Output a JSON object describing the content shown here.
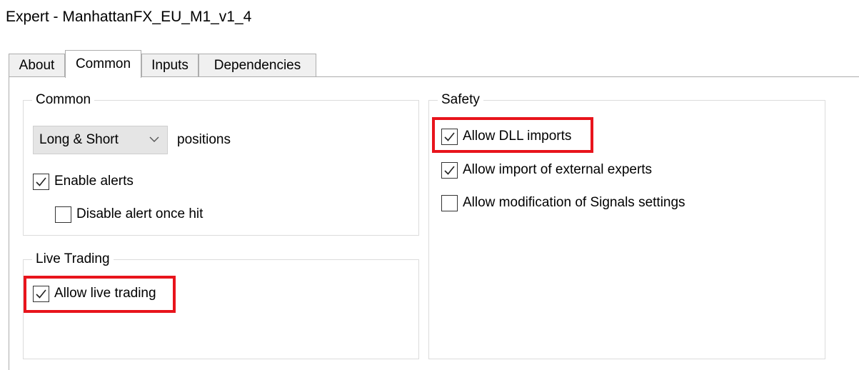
{
  "window": {
    "title": "Expert - ManhattanFX_EU_M1_v1_4"
  },
  "tabs": [
    {
      "label": "About",
      "active": false
    },
    {
      "label": "Common",
      "active": true
    },
    {
      "label": "Inputs",
      "active": false
    },
    {
      "label": "Dependencies",
      "active": false
    }
  ],
  "common_group": {
    "title": "Common",
    "positions_select": {
      "value": "Long & Short",
      "icon": "chevron-down-icon"
    },
    "positions_label": "positions",
    "enable_alerts": {
      "label": "Enable alerts",
      "checked": true
    },
    "disable_alert_once_hit": {
      "label": "Disable alert once hit",
      "checked": false
    }
  },
  "live_trading_group": {
    "title": "Live Trading",
    "allow_live_trading": {
      "label": "Allow live trading",
      "checked": true
    }
  },
  "safety_group": {
    "title": "Safety",
    "allow_dll_imports": {
      "label": "Allow DLL imports",
      "checked": true
    },
    "allow_import_external_experts": {
      "label": "Allow import of external experts",
      "checked": true
    },
    "allow_modification_signals": {
      "label": "Allow modification of Signals settings",
      "checked": false
    }
  },
  "colors": {
    "highlight": "#e8141c",
    "tab_inactive_bg": "#f0f0f0",
    "select_bg": "#e5e5e5"
  }
}
